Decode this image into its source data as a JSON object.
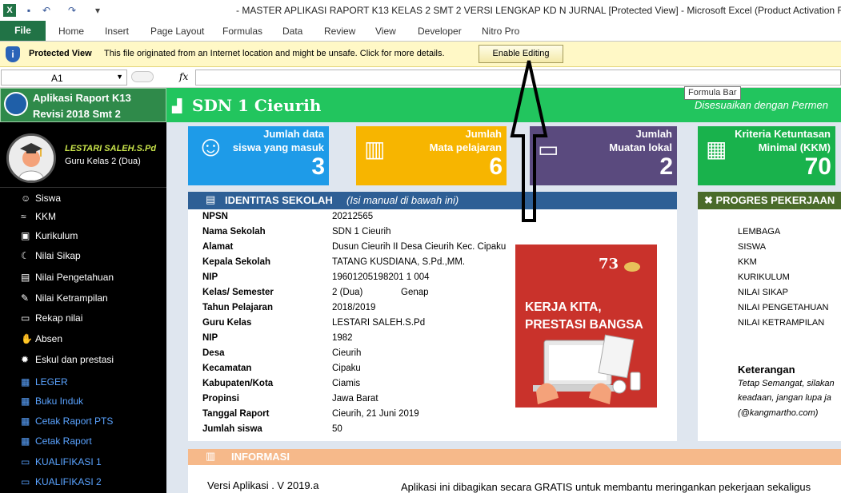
{
  "window": {
    "title": "- MASTER APLIKASI RAPORT K13 KELAS 2 SMT 2 VERSI LENGKAP KD N JURNAL  [Protected View]  -  Microsoft Excel (Product Activation Failed)"
  },
  "ribbon": {
    "file_label": "File",
    "tabs": [
      "Home",
      "Insert",
      "Page Layout",
      "Formulas",
      "Data",
      "Review",
      "View",
      "Developer",
      "Nitro Pro"
    ]
  },
  "protected_view": {
    "title": "Protected View",
    "message": "This file originated from an Internet location and might be unsafe. Click for more details.",
    "button": "Enable Editing"
  },
  "formula_bar": {
    "name_box": "A1",
    "fx": "fx",
    "value": "",
    "tooltip": "Formula Bar"
  },
  "sidebar": {
    "app_title_1": "Aplikasi Raport K13",
    "app_title_2": "Revisi 2018 Smt 2",
    "user_name": "LESTARI SALEH.S.Pd",
    "user_role": "Guru Kelas 2 (Dua)",
    "items": [
      {
        "label": "Siswa",
        "icon": "☺"
      },
      {
        "label": "KKM",
        "icon": "≈"
      },
      {
        "label": "Kurikulum",
        "icon": "▣"
      },
      {
        "label": "Nilai Sikap",
        "icon": "☾"
      },
      {
        "label": "Nilai Pengetahuan",
        "icon": "▤"
      },
      {
        "label": "Nilai Ketrampilan",
        "icon": "✎"
      },
      {
        "label": "Rekap nilai",
        "icon": "▭"
      },
      {
        "label": "Absen",
        "icon": "✋"
      },
      {
        "label": "Eskul dan prestasi",
        "icon": "✹"
      },
      {
        "label": "LEGER",
        "icon": "▦"
      },
      {
        "label": "Buku Induk",
        "icon": "▦"
      },
      {
        "label": "Cetak Raport PTS",
        "icon": "▦"
      },
      {
        "label": "Cetak Raport",
        "icon": "▦"
      },
      {
        "label": "KUALIFIKASI 1",
        "icon": "▭"
      },
      {
        "label": "KUALIFIKASI 2",
        "icon": "▭"
      }
    ]
  },
  "header": {
    "school": "SDN 1 Cieurih",
    "subtitle": "Disesuaikan dengan Permen"
  },
  "cards": [
    {
      "line1": "Jumlah data",
      "line2": "siswa yang masuk",
      "value": "3",
      "color": "#1e9be8",
      "icon": "☺"
    },
    {
      "line1": "Jumlah",
      "line2": "Mata pelajaran",
      "value": "6",
      "color": "#f7b500",
      "icon": "▥"
    },
    {
      "line1": "Jumlah",
      "line2": "Muatan lokal",
      "value": "2",
      "color": "#5a4a7e",
      "icon": "▭"
    },
    {
      "line1": "Kriteria Ketuntasan",
      "line2": "Minimal (KKM)",
      "value": "70",
      "color": "#19b24c",
      "icon": "▦"
    }
  ],
  "identity": {
    "title": "IDENTITAS SEKOLAH",
    "subtitle": "(Isi manual di bawah ini)",
    "rows": [
      {
        "label": "NPSN",
        "value": "20212565"
      },
      {
        "label": "Nama Sekolah",
        "value": "SDN 1 Cieurih"
      },
      {
        "label": "Alamat",
        "value": "Dusun Cieurih II Desa Cieurih Kec. Cipaku"
      },
      {
        "label": "Kepala Sekolah",
        "value": "TATANG KUSDIANA, S.Pd.,MM."
      },
      {
        "label": "NIP",
        "value": "19601205198201 1 004"
      },
      {
        "label": "Kelas/ Semester",
        "value": "2 (Dua)",
        "extra": "Genap"
      },
      {
        "label": "Tahun Pelajaran",
        "value": "2018/2019"
      },
      {
        "label": "Guru Kelas",
        "value": "LESTARI SALEH.S.Pd"
      },
      {
        "label": "NIP",
        "value": "1982"
      },
      {
        "label": "Desa",
        "value": "Cieurih"
      },
      {
        "label": "Kecamatan",
        "value": "Cipaku"
      },
      {
        "label": "Kabupaten/Kota",
        "value": "Ciamis"
      },
      {
        "label": "Propinsi",
        "value": "Jawa Barat"
      },
      {
        "label": "Tanggal Raport",
        "value": "Cieurih, 21 Juni 2019"
      },
      {
        "label": "Jumlah siswa",
        "value": "50"
      }
    ],
    "poster_line1": "KERJA KITA,",
    "poster_line2": "PRESTASI BANGSA",
    "poster_logo": "73"
  },
  "progres": {
    "title": "PROGRES PEKERJAAN",
    "items": [
      "LEMBAGA",
      "SISWA",
      "KKM",
      "KURIKULUM",
      "NILAI SIKAP",
      "NILAI PENGETAHUAN",
      "NILAI KETRAMPILAN"
    ],
    "keterangan_title": "Keterangan",
    "keterangan_lines": [
      "Tetap Semangat, silakan",
      "keadaan, jangan lupa ja",
      "(@kangmartho.com)"
    ]
  },
  "informasi": {
    "title": "INFORMASI",
    "version": "Versi Aplikasi . V 2019.a",
    "description": "Aplikasi ini dibagikan secara GRATIS untuk membantu meringankan pekerjaan sekaligus"
  }
}
